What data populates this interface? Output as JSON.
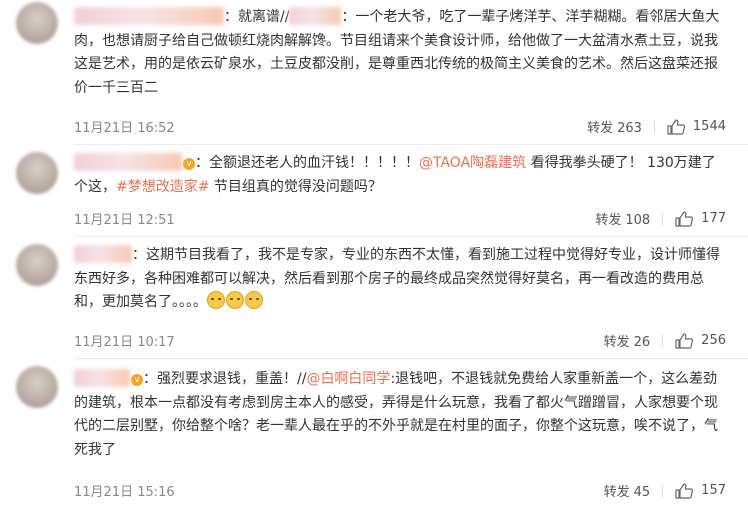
{
  "comments": [
    {
      "text_before": "：就离谱//",
      "text_after": "：一个老大爷，吃了一辈子烤洋芋、洋芋糊糊。看邻居大鱼大肉，也想请厨子给自己做顿红烧肉解解馋。节目组请来个美食设计师，给他做了一大盆清水煮土豆，说我这是艺术，用的是依云矿泉水，土豆皮都没削，是尊重西北传统的极简主义美食的艺术。然后这盘菜还报价一千三百二",
      "time": "11月21日 16:52",
      "forward_label": "转发",
      "forward_count": "263",
      "like_count": "1544"
    },
    {
      "text_before": "：全额退还老人的血汗钱！！！！！",
      "mention": "@TAOA陶磊建筑",
      "text_mid": " 看得我拳头硬了！ 130万建了个这，",
      "hashtag": "#梦想改造家#",
      "text_after": " 节目组真的觉得没问题吗？",
      "time": "11月21日 12:51",
      "forward_label": "转发",
      "forward_count": "108",
      "like_count": "177"
    },
    {
      "text": "：这期节目我看了，我不是专家，专业的东西不太懂，看到施工过程中觉得好专业，设计师懂得东西好多，各种困难都可以解决，然后看到那个房子的最终成品突然觉得好莫名，再一看改造的费用总和，更加莫名了。。。。",
      "time": "11月21日 10:17",
      "forward_label": "转发",
      "forward_count": "26",
      "like_count": "256"
    },
    {
      "text_before": "：强烈要求退钱，重盖！//",
      "mention": "@白啊白同学",
      "text_after": ":退钱吧，不退钱就免费给人家重新盖一个，这么差劲的建筑，根本一点都没有考虑到房主本人的感受，弄得是什么玩意，我看了都火气蹭蹭冒，人家想要个现代的二层别墅，你给整个啥？老一辈人最在乎的不外乎就是在村里的面子，你整个这玩意，唉不说了，气死我了",
      "time": "11月21日 15:16",
      "forward_label": "转发",
      "forward_count": "45",
      "like_count": "157"
    }
  ],
  "colors": {
    "link": "#eb7350",
    "meta": "#888888",
    "text": "#333333"
  }
}
